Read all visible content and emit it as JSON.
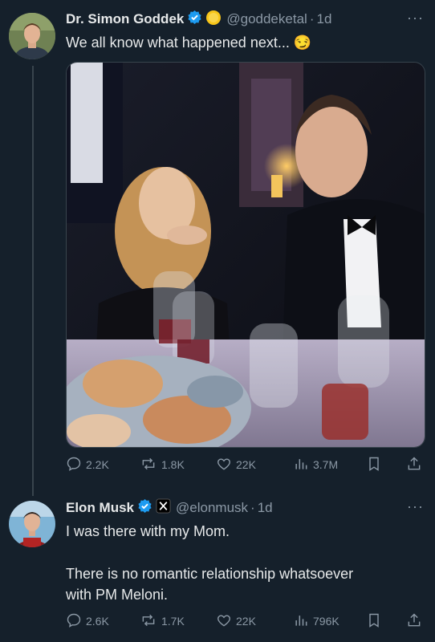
{
  "tweet1": {
    "author_name": "Dr. Simon Goddek",
    "handle": "@goddeketal",
    "dot": "·",
    "time": "1d",
    "text": "We all know what happened next...",
    "emoji": "😏",
    "stats": {
      "replies": "2.2K",
      "reposts": "1.8K",
      "likes": "22K",
      "views": "3.7M"
    }
  },
  "tweet2": {
    "author_name": "Elon Musk",
    "handle": "@elonmusk",
    "dot": "·",
    "time": "1d",
    "line1": "I was there with my Mom.",
    "line2": "There is no romantic relationship whatsoever",
    "line3": "with PM Meloni.",
    "stats": {
      "replies": "2.6K",
      "reposts": "1.7K",
      "likes": "22K",
      "views": "796K"
    }
  },
  "more_label": "···",
  "colors": {
    "background": "#15202b",
    "text": "#e7e9ea",
    "muted": "#8b98a5",
    "verified": "#1d9bf0",
    "gold": "#f7c519",
    "divider": "#38444d"
  },
  "icons": [
    "reply-icon",
    "repost-icon",
    "like-icon",
    "views-icon",
    "bookmark-icon",
    "share-icon",
    "verified-badge-icon",
    "x-affiliate-icon"
  ]
}
